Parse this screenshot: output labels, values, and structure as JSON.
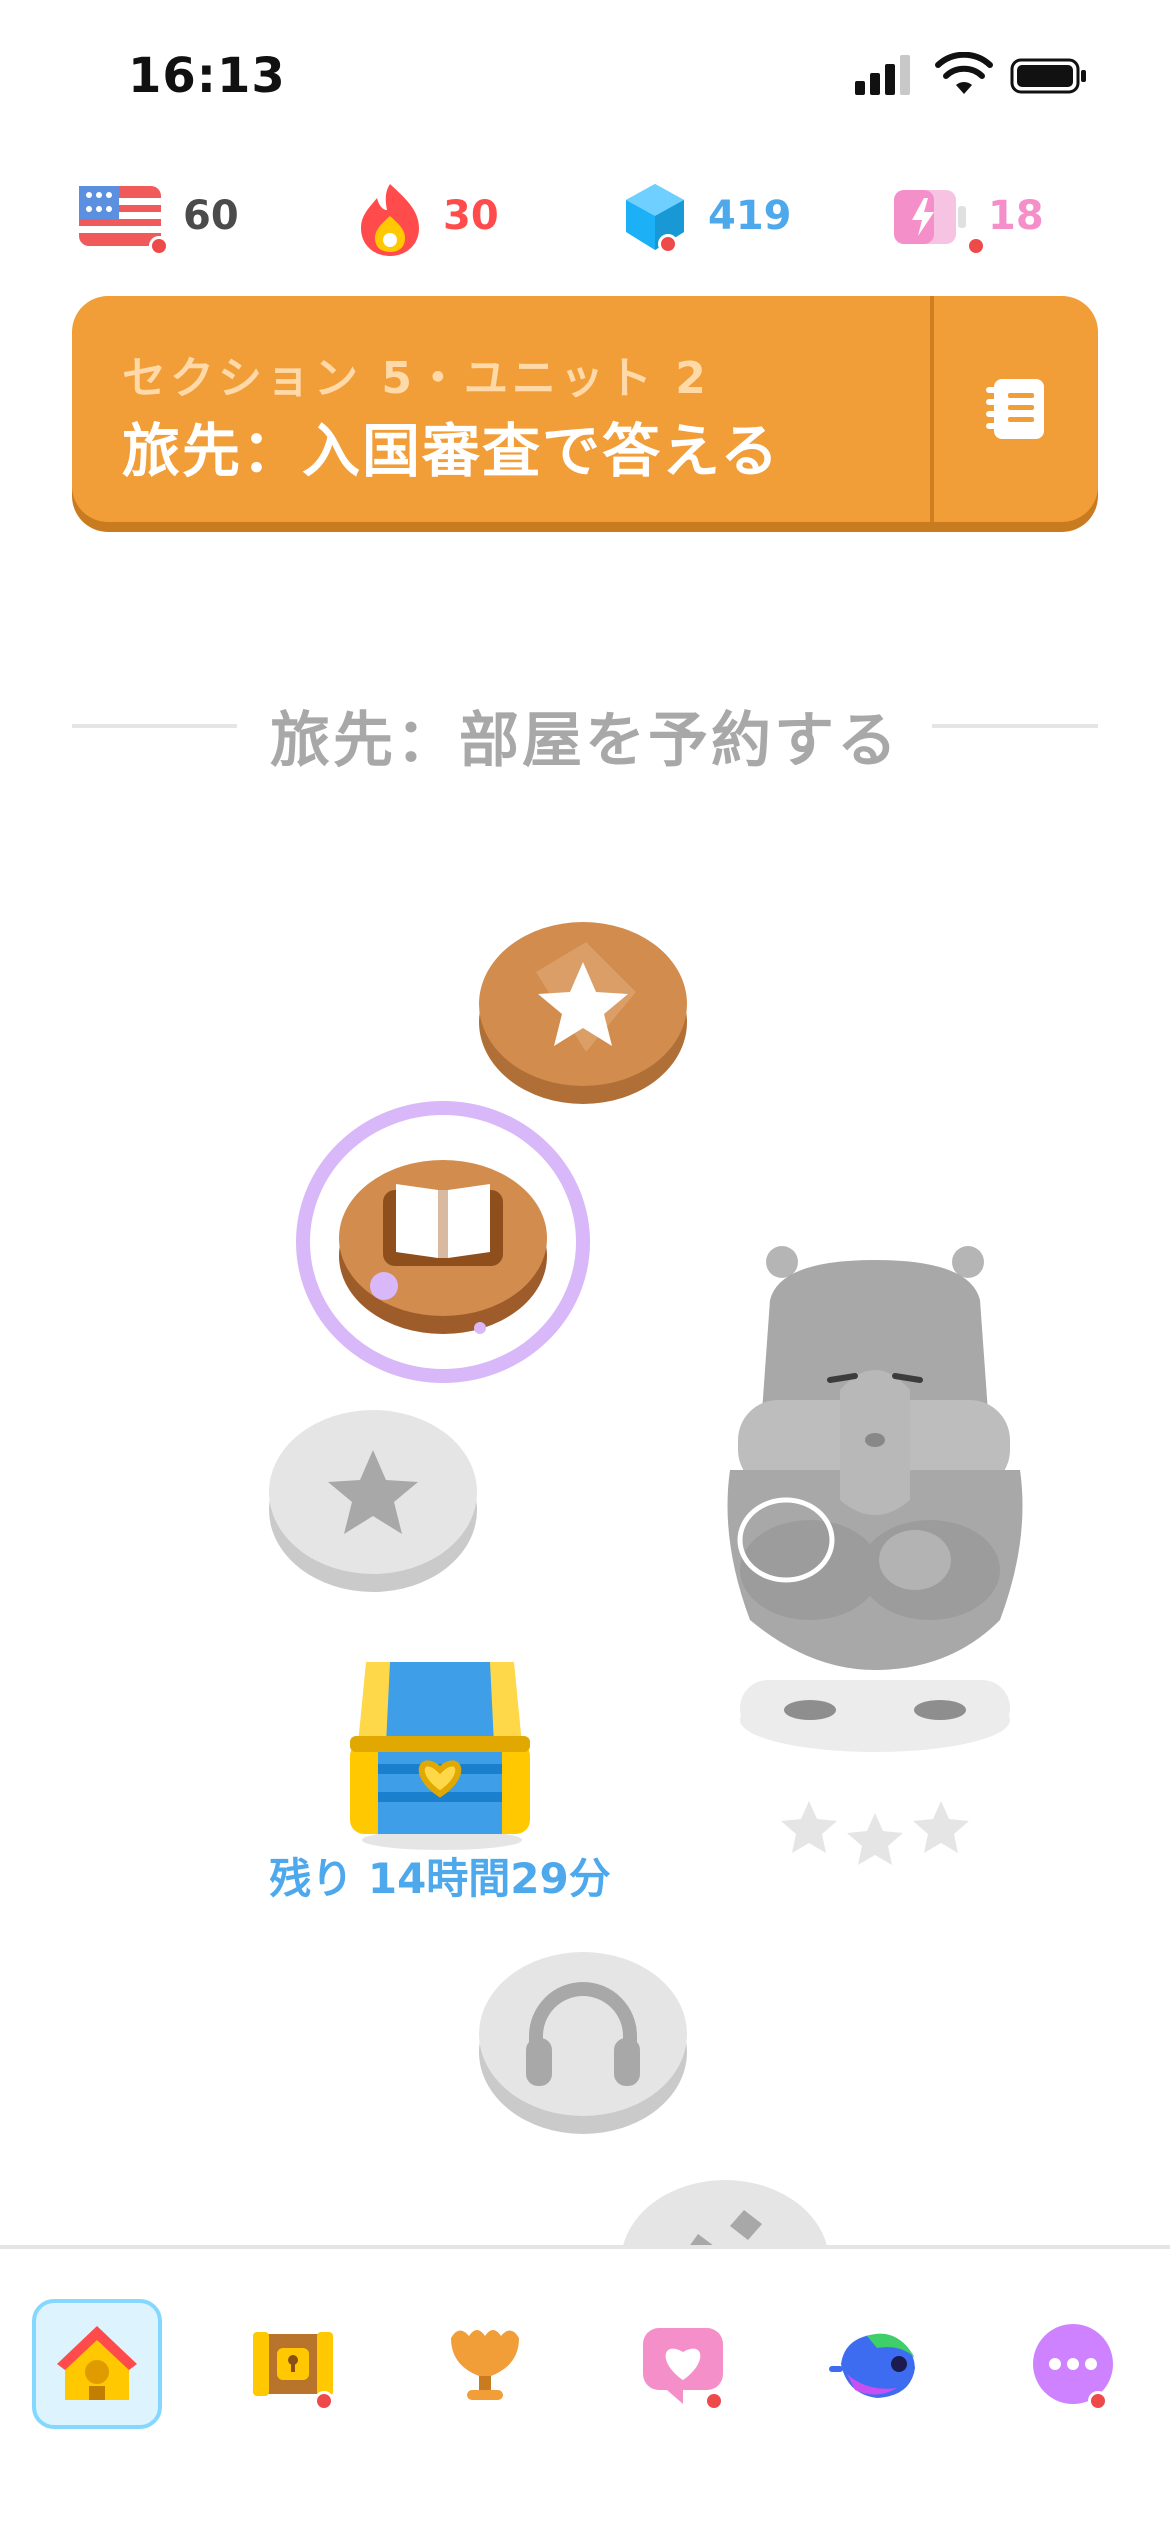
{
  "status_bar": {
    "time": "16:13"
  },
  "stats": {
    "language_count": "60",
    "streak": "30",
    "gems": "419",
    "energy": "18"
  },
  "colors": {
    "banner": "#f19d38",
    "streak": "#ff4b4b",
    "gems": "#4ea8ec",
    "energy": "#f58fc9",
    "lesson_active_ring": "#d8b8f8",
    "chest_timer": "#4ea8ec"
  },
  "unit_banner": {
    "section_label": "セクション 5・ユニット 2",
    "title": "旅先：入国審査で答える",
    "guide_icon": "notebook-icon"
  },
  "section_divider": {
    "label": "旅先：部屋を予約する"
  },
  "path": {
    "chest_timer": "残り 14時間29分",
    "nodes": [
      {
        "type": "star",
        "state": "completed"
      },
      {
        "type": "book",
        "state": "active"
      },
      {
        "type": "star",
        "state": "locked"
      },
      {
        "type": "chest",
        "state": "locked"
      },
      {
        "type": "headphones",
        "state": "locked"
      },
      {
        "type": "dumbbell",
        "state": "locked"
      }
    ]
  },
  "nav": {
    "items": [
      "home-icon",
      "characters-icon",
      "leaderboard-icon",
      "friends-icon",
      "duo-icon",
      "more-icon"
    ],
    "active": "home-icon"
  }
}
